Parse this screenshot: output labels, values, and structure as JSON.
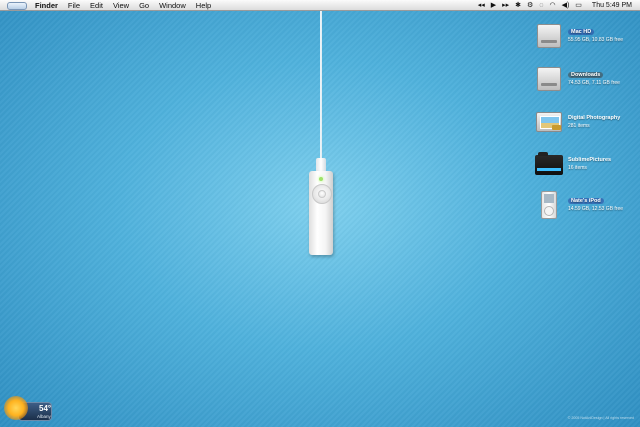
{
  "menubar": {
    "app_name": "Finder",
    "menus": [
      "File",
      "Edit",
      "View",
      "Go",
      "Window",
      "Help"
    ],
    "clock": "Thu 5:49 PM"
  },
  "desktop": {
    "items": [
      {
        "name": "Mac HD",
        "detail": "55.95 GB, 10.83 GB free",
        "icon": "hard-drive-icon"
      },
      {
        "name": "Downloads",
        "detail": "74.53 GB, 7.11 GB free",
        "icon": "hard-drive-icon"
      },
      {
        "name": "Digital Photography",
        "detail": "281 items",
        "icon": "photo-folder-icon"
      },
      {
        "name": "SublimePictures",
        "detail": "16 items",
        "icon": "black-folder-icon"
      },
      {
        "name": "Nate's iPod",
        "detail": "14.59 GB, 12.53 GB free",
        "icon": "ipod-icon"
      }
    ]
  },
  "weather": {
    "temperature": "54°",
    "city": "Albany"
  },
  "footer": {
    "copyright": "© 2005 NotAnIDesign | All rights reserved"
  },
  "colors": {
    "desktop_center": "#7fd0ee",
    "desktop_edge": "#2f8fc2",
    "label_highlight": "#2846a0"
  }
}
